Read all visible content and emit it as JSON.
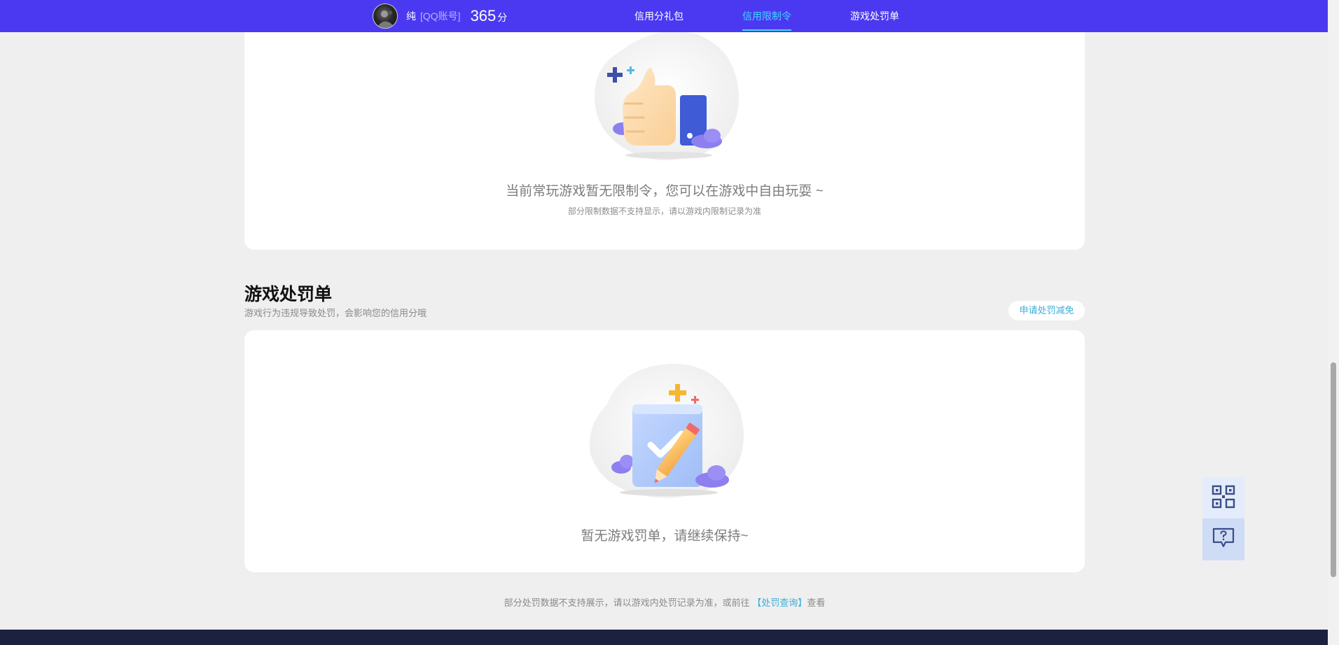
{
  "header": {
    "user_name": "纯",
    "account_type": "[QQ账号]",
    "score": "365",
    "score_unit": "分",
    "nav": [
      {
        "label": "信用分礼包",
        "active": false
      },
      {
        "label": "信用限制令",
        "active": true
      },
      {
        "label": "游戏处罚单",
        "active": false
      }
    ],
    "accent_color": "#4b39f2",
    "active_color": "#40d8ff"
  },
  "restrictions": {
    "icon": "thumbs-up-illustration",
    "empty_message": "当前常玩游戏暂无限制令，您可以在游戏中自由玩耍 ~",
    "note": "部分限制数据不支持显示，请以游戏内限制记录为准"
  },
  "penalties": {
    "title": "游戏处罚单",
    "description": "游戏行为违规导致处罚，会影响您的信用分哦",
    "appeal_label": "申请处罚减免",
    "icon": "clipboard-check-illustration",
    "empty_message": "暂无游戏罚单，请继续保持~"
  },
  "footer": {
    "text_before": "部分处罚数据不支持展示，请以游戏内处罚记录为准，或前往",
    "link_label": "【处罚查询】",
    "text_after": "查看"
  },
  "side_tools": [
    {
      "icon": "qr-code-icon"
    },
    {
      "icon": "help-chat-icon"
    }
  ]
}
